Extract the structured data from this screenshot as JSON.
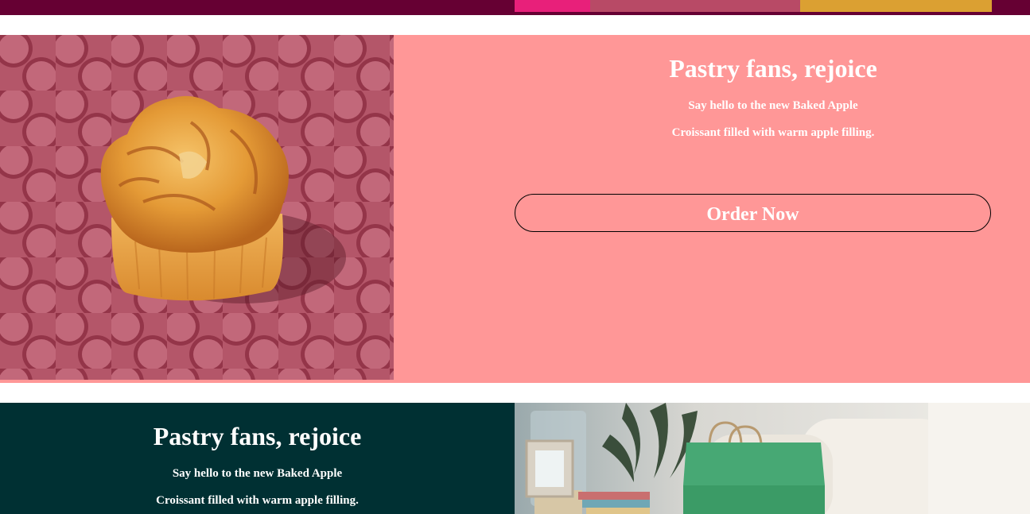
{
  "colors": {
    "top_strip": "#660033",
    "section1_bg": "#ff9797",
    "section2_bg": "#003033",
    "text": "#ffffff",
    "button_border": "#000000"
  },
  "promo_primary": {
    "headline": "Pastry fans, rejoice",
    "subline_1": "Say hello to the new Baked Apple",
    "subline_2": "Croissant filled with warm apple filling.",
    "cta_label": "Order Now"
  },
  "promo_secondary": {
    "headline": "Pastry fans, rejoice",
    "subline_1": "Say hello to the new Baked Apple",
    "subline_2": "Croissant filled with warm apple filling."
  }
}
